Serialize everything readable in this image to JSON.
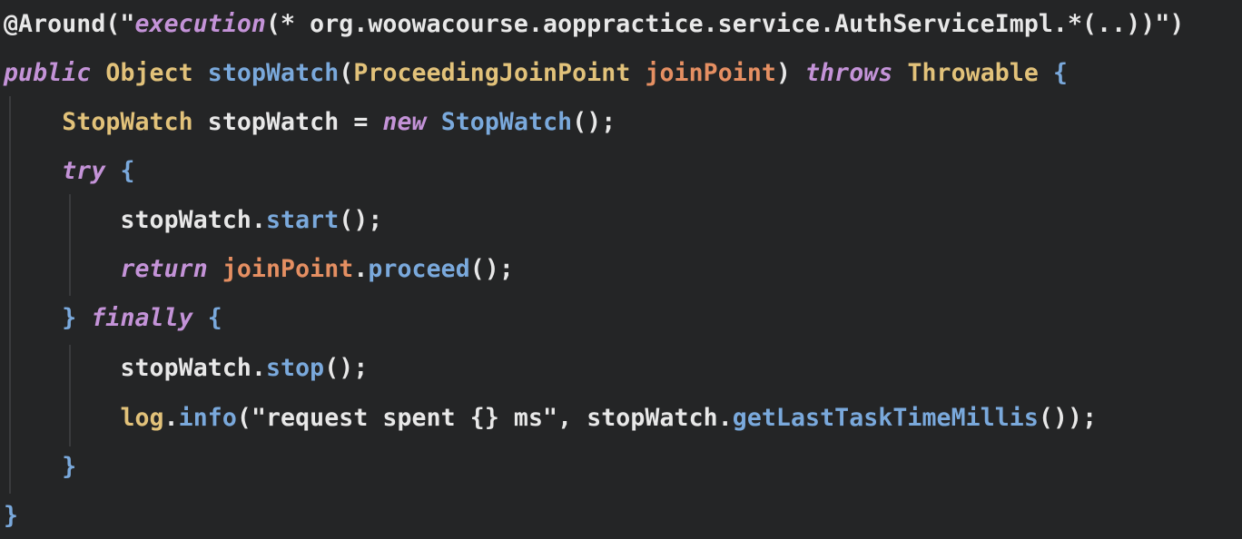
{
  "editor": {
    "background": "#242526",
    "colors": {
      "keyword": "#c493d8",
      "type": "#e2c27a",
      "function": "#7aa9dc",
      "parameter": "#e58f62",
      "text": "#e8e8e8"
    },
    "lines": [
      {
        "tokens": [
          {
            "t": "@Around(\"",
            "c": "annot"
          },
          {
            "t": "execution",
            "c": "strit"
          },
          {
            "t": "(* org.woowacourse.aoppractice.service.AuthServiceImpl.*(..))\")",
            "c": "str"
          }
        ]
      },
      {
        "tokens": [
          {
            "t": "public",
            "c": "kw"
          },
          {
            "t": " ",
            "c": "punc"
          },
          {
            "t": "Object",
            "c": "type"
          },
          {
            "t": " ",
            "c": "punc"
          },
          {
            "t": "stopWatch",
            "c": "fn"
          },
          {
            "t": "(",
            "c": "punc"
          },
          {
            "t": "ProceedingJoinPoint",
            "c": "type"
          },
          {
            "t": " ",
            "c": "punc"
          },
          {
            "t": "joinPoint",
            "c": "param"
          },
          {
            "t": ") ",
            "c": "punc"
          },
          {
            "t": "throws",
            "c": "kw"
          },
          {
            "t": " ",
            "c": "punc"
          },
          {
            "t": "Throwable",
            "c": "type"
          },
          {
            "t": " {",
            "c": "brace"
          }
        ]
      },
      {
        "tokens": [
          {
            "t": "    ",
            "c": "punc"
          },
          {
            "t": "StopWatch",
            "c": "type"
          },
          {
            "t": " stopWatch ",
            "c": "local"
          },
          {
            "t": "=",
            "c": "punc"
          },
          {
            "t": " ",
            "c": "punc"
          },
          {
            "t": "new",
            "c": "kw"
          },
          {
            "t": " ",
            "c": "punc"
          },
          {
            "t": "StopWatch",
            "c": "fn"
          },
          {
            "t": "();",
            "c": "punc"
          }
        ]
      },
      {
        "tokens": [
          {
            "t": "    ",
            "c": "punc"
          },
          {
            "t": "try",
            "c": "kw"
          },
          {
            "t": " {",
            "c": "brace"
          }
        ]
      },
      {
        "tokens": [
          {
            "t": "        ",
            "c": "punc"
          },
          {
            "t": "stopWatch",
            "c": "local"
          },
          {
            "t": ".",
            "c": "punc"
          },
          {
            "t": "start",
            "c": "method"
          },
          {
            "t": "();",
            "c": "punc"
          }
        ]
      },
      {
        "tokens": [
          {
            "t": "        ",
            "c": "punc"
          },
          {
            "t": "return",
            "c": "kw"
          },
          {
            "t": " ",
            "c": "punc"
          },
          {
            "t": "joinPoint",
            "c": "param"
          },
          {
            "t": ".",
            "c": "punc"
          },
          {
            "t": "proceed",
            "c": "method"
          },
          {
            "t": "();",
            "c": "punc"
          }
        ]
      },
      {
        "tokens": [
          {
            "t": "    ",
            "c": "punc"
          },
          {
            "t": "}",
            "c": "brace"
          },
          {
            "t": " ",
            "c": "punc"
          },
          {
            "t": "finally",
            "c": "kw"
          },
          {
            "t": " {",
            "c": "brace"
          }
        ]
      },
      {
        "tokens": [
          {
            "t": "        ",
            "c": "punc"
          },
          {
            "t": "stopWatch",
            "c": "local"
          },
          {
            "t": ".",
            "c": "punc"
          },
          {
            "t": "stop",
            "c": "method"
          },
          {
            "t": "();",
            "c": "punc"
          }
        ]
      },
      {
        "tokens": [
          {
            "t": "        ",
            "c": "punc"
          },
          {
            "t": "log",
            "c": "logv"
          },
          {
            "t": ".",
            "c": "punc"
          },
          {
            "t": "info",
            "c": "method"
          },
          {
            "t": "(\"request spent {} ms\", ",
            "c": "str"
          },
          {
            "t": "stopWatch",
            "c": "local"
          },
          {
            "t": ".",
            "c": "punc"
          },
          {
            "t": "getLastTaskTimeMillis",
            "c": "method"
          },
          {
            "t": "());",
            "c": "punc"
          }
        ]
      },
      {
        "tokens": [
          {
            "t": "    ",
            "c": "punc"
          },
          {
            "t": "}",
            "c": "brace"
          }
        ]
      },
      {
        "tokens": [
          {
            "t": "}",
            "c": "brace"
          }
        ]
      }
    ]
  }
}
